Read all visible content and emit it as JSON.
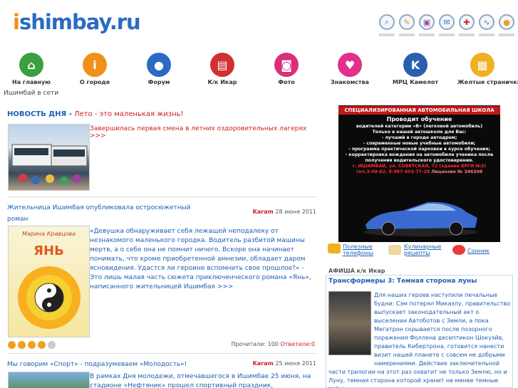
{
  "site": {
    "logo_i": "i",
    "logo_rest": "shimbay.ru"
  },
  "toolbar": {
    "icons": [
      "search-icon",
      "tools-icon",
      "edit-icon",
      "mail-icon",
      "plus-icon",
      "chart-icon",
      "sun-icon"
    ],
    "colors": [
      "#3a7ac9",
      "#e8a020",
      "#9a4aa0",
      "#3a7ac9",
      "#d03030",
      "#3aa040",
      "#e8a020"
    ]
  },
  "nav": {
    "items": [
      {
        "label": "На главную",
        "color": "#3aa040",
        "glyph": "⌂"
      },
      {
        "label": "О городе",
        "color": "#f0901a",
        "glyph": "i"
      },
      {
        "label": "Форум",
        "color": "#2a6bc4",
        "glyph": "●"
      },
      {
        "label": "К/к Икар",
        "color": "#d03030",
        "glyph": "▤"
      },
      {
        "label": "Фото",
        "color": "#d8307a",
        "glyph": "◙"
      },
      {
        "label": "Знакомства",
        "color": "#e0308a",
        "glyph": "♥"
      },
      {
        "label": "МРЦ Камелот",
        "color": "#2a5fb0",
        "glyph": "K"
      },
      {
        "label": "Желтые странички",
        "color": "#f0b020",
        "glyph": "▦"
      }
    ],
    "net_label": "Ишимбай в сети"
  },
  "news": {
    "kicker": "НОВОСТЬ ДНЯ -",
    "title": "Лето - это маленькая жизнь!",
    "summary": "Завершилась первая смена в летних оздоровительных лагерях >>>"
  },
  "article1": {
    "title": "Жительница Ишимбая опубликовала остросюжетный роман",
    "author": "Karam",
    "date": "28 июня 2011",
    "body": "«Девушка обнаруживает себя лежащей неподалеку от незнакомого маленького городка. Водитель разбитой машины мертв, а о себе она не помнит ничего. Вскоре она начинает понимать, что кроме приобретенной амнезии, обладает даром ясновидения. Удастся ли героине вспомнить свое прошлое?» - Это лишь малая часть сюжета приключенческого романа «Янь», написанного жительницей Ишимбая >>>",
    "cover_author": "Марина Кравцова",
    "cover_title": "ЯНЬ",
    "rating": 4,
    "rating_max": 5,
    "reads_label": "Прочитали:",
    "reads_value": "100",
    "replies_label": "Ответили:",
    "replies_value": "0"
  },
  "article2": {
    "title": "Мы говорим «Спорт» - подразумеваем «Молодость»!",
    "author": "Karam",
    "date": "25 июня 2011",
    "body": "В рамках Дня молодежи, отмечавшегося в Ишимбае 25 июня, на стадионе «Нефтяник» прошел спортивный праздник, участниками которого стали"
  },
  "ad": {
    "title": "СПЕЦИАЛИЗИРОВАННАЯ АВТОМОБИЛЬНАЯ ШКОЛА",
    "lead": "Проводит обучение",
    "lines": [
      "водителей категории «В» (легковой автомобиль)",
      "Только в нашей автошколе для Вас:",
      "- лучший в городе автодром;",
      "- современные новые учебные автомобили;",
      "- программа практической парковки в курсе обучения;",
      "- корректировка вождения на автомобиле ученика после",
      "получения водительского удостоверения."
    ],
    "address": "г. ИШИМБАЙ, ул. СОВЕТСКАЯ, 72 (здание БРГИ №2)",
    "phones": "тел.3-09-62, 8-987-603-77-28",
    "license": "Лицензия № 346308"
  },
  "links": [
    {
      "label_1": "Полезные",
      "label_2": "телефоны"
    },
    {
      "label_1": "Кулинарные",
      "label_2": "рецепты"
    },
    {
      "label_1": "Сонник",
      "label_2": ""
    }
  ],
  "afisha": {
    "label": "АФИША к/к Икар",
    "film_title": "Трансформеры 3: Темная сторона луны",
    "film_text": "Для наших героев наступили печальные будни: Сэм потерял Микаэлу, правительство выпускает законодательный акт о выселении Автоботов с Земли, а пока Мегатрон скрывается после позорного поражения Фоллена десептикон Шокуэйв, правитель Кибертрона, готовится нанести визит нашей планете с совсем не добрыми намерениями. Действие заключительной части трилогии на этот раз охватит не только Землю, но и Луну, темная сторона которой хранит не менее темные тайны."
  }
}
